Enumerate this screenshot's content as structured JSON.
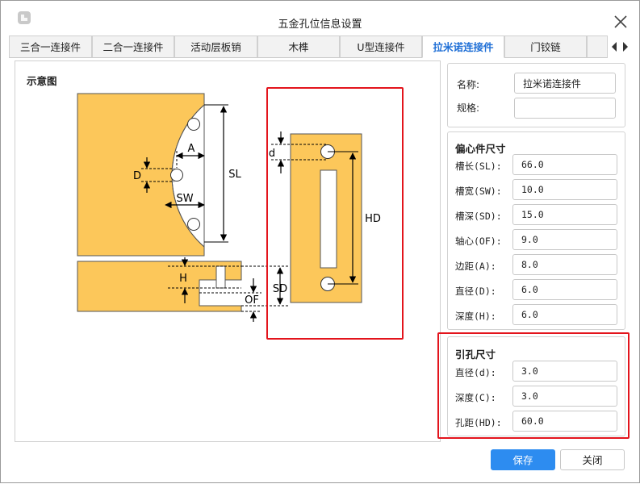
{
  "window": {
    "title": "五金孔位信息设置"
  },
  "tabs": [
    {
      "label": "三合一连接件",
      "active": false
    },
    {
      "label": "二合一连接件",
      "active": false
    },
    {
      "label": "活动层板销",
      "active": false
    },
    {
      "label": "木榫",
      "active": false
    },
    {
      "label": "U型连接件",
      "active": false
    },
    {
      "label": "拉米诺连接件",
      "active": true
    },
    {
      "label": "门铰链",
      "active": false
    }
  ],
  "diagram": {
    "label": "示意图",
    "dims": {
      "a": "A",
      "d": "D",
      "sw": "SW",
      "sl": "SL",
      "h": "H",
      "of": "OF",
      "sd": "SD",
      "d_small": "d",
      "hd": "HD"
    }
  },
  "basic": {
    "name_label": "名称:",
    "name_value": "拉米诺连接件",
    "spec_label": "规格:",
    "spec_value": ""
  },
  "eccentric": {
    "title": "偏心件尺寸",
    "fields": [
      {
        "label": "槽长(SL):",
        "value": "66.0"
      },
      {
        "label": "槽宽(SW):",
        "value": "10.0"
      },
      {
        "label": "槽深(SD):",
        "value": "15.0"
      },
      {
        "label": "轴心(OF):",
        "value": "9.0"
      },
      {
        "label": "边距(A):",
        "value": "8.0"
      },
      {
        "label": "直径(D):",
        "value": "6.0"
      },
      {
        "label": "深度(H):",
        "value": "6.0"
      }
    ]
  },
  "pilot": {
    "title": "引孔尺寸",
    "fields": [
      {
        "label": "直径(d):",
        "value": "3.0"
      },
      {
        "label": "深度(C):",
        "value": "3.0"
      },
      {
        "label": "孔距(HD):",
        "value": "60.0"
      }
    ]
  },
  "buttons": {
    "save": "保存",
    "close": "关闭"
  },
  "colors": {
    "wood": "#fcc75a",
    "accent": "#2d8cf0",
    "tab_active": "#1f6fd6",
    "highlight": "#e3141c"
  }
}
